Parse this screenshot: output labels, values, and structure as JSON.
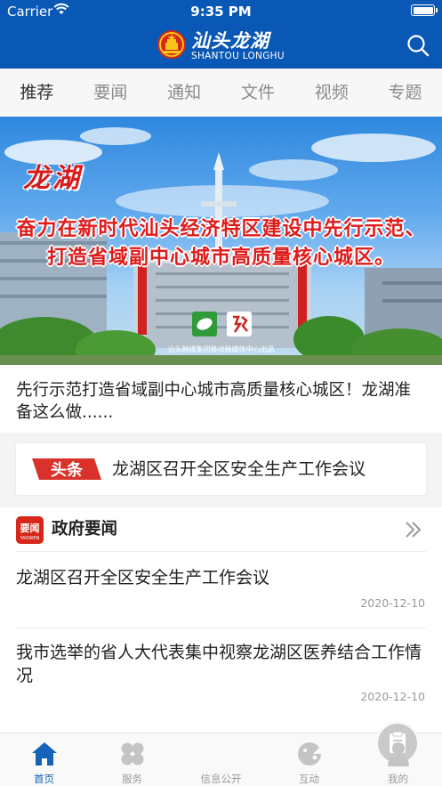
{
  "status_bar": {
    "carrier": "Carrier",
    "time": "9:35 PM",
    "battery_level": 1.0
  },
  "header": {
    "brand_cn": "汕头龙湖",
    "brand_en": "SHANTOU LONGHU",
    "search_icon": "search-icon",
    "background": "#0a58b5"
  },
  "tabs": [
    {
      "label": "推荐",
      "active": true
    },
    {
      "label": "要闻",
      "active": false
    },
    {
      "label": "通知",
      "active": false
    },
    {
      "label": "文件",
      "active": false
    },
    {
      "label": "视频",
      "active": false
    },
    {
      "label": "专题",
      "active": false
    }
  ],
  "banner": {
    "city": "龙湖",
    "slogan_line1": "奋力在新时代汕头经济特区建设中先行示范、",
    "slogan_line2": "打造省域副中心城市高质量核心城区。",
    "credit": "汕头融媒集团移动融媒体中心出品",
    "slogan_color": "#e01b1b"
  },
  "headline": {
    "text": "先行示范打造省域副中心城市高质量核心城区！龙湖准备这么做......"
  },
  "toutiao": {
    "badge": "头条",
    "text": "龙湖区召开全区安全生产工作会议",
    "badge_color": "#d9322a"
  },
  "news_section": {
    "icon_text": "要闻",
    "icon_sub": "YAOWEN",
    "title": "政府要闻",
    "more_icon": "double-chevron-right-icon",
    "items": [
      {
        "title": "龙湖区召开全区安全生产工作会议",
        "date": "2020-12-10"
      },
      {
        "title": "我市选举的省人大代表集中视察龙湖区医养结合工作情况",
        "date": "2020-12-10"
      }
    ]
  },
  "tabbar": {
    "items": [
      {
        "label": "首页",
        "icon": "home-icon",
        "active": true
      },
      {
        "label": "服务",
        "icon": "grid-icon",
        "active": false
      },
      {
        "label": "信息公开",
        "icon": "document-icon",
        "active": false
      },
      {
        "label": "互动",
        "icon": "chat-icon",
        "active": false
      },
      {
        "label": "我的",
        "icon": "user-icon",
        "active": false
      }
    ],
    "active_color": "#1463b8"
  }
}
